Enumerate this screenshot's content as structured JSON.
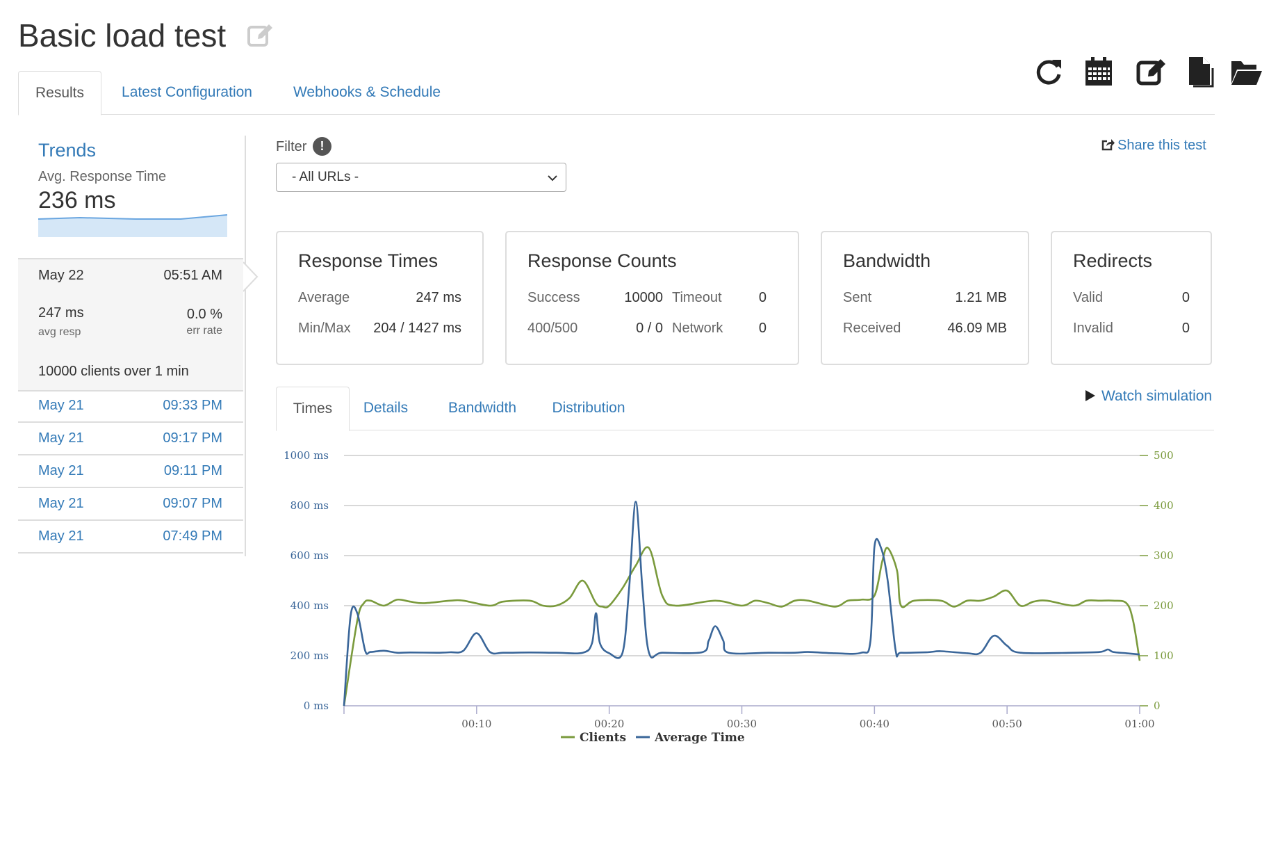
{
  "page": {
    "title": "Basic load test"
  },
  "tabs": [
    {
      "label": "Results",
      "active": true
    },
    {
      "label": "Latest Configuration",
      "active": false
    },
    {
      "label": "Webhooks & Schedule",
      "active": false
    }
  ],
  "toolbar": {
    "icons": [
      "refresh-icon",
      "calendar-icon",
      "edit-icon",
      "copy-file-icon",
      "folder-open-icon"
    ]
  },
  "trends": {
    "title": "Trends",
    "avg_label": "Avg. Response Time",
    "avg_value": "236 ms",
    "selected": {
      "date": "May 22",
      "time": "05:51 AM",
      "avg_resp_value": "247 ms",
      "avg_resp_label": "avg resp",
      "err_rate_value": "0.0 %",
      "err_rate_label": "err rate",
      "clients": "10000 clients over 1 min"
    },
    "runs": [
      {
        "date": "May 21",
        "time": "09:33 PM"
      },
      {
        "date": "May 21",
        "time": "09:17 PM"
      },
      {
        "date": "May 21",
        "time": "09:11 PM"
      },
      {
        "date": "May 21",
        "time": "09:07 PM"
      },
      {
        "date": "May 21",
        "time": "07:49 PM"
      }
    ]
  },
  "filter": {
    "label": "Filter",
    "info": "!",
    "selected": "- All URLs -"
  },
  "share": {
    "label": "Share this test"
  },
  "cards": {
    "response_times": {
      "title": "Response Times",
      "average_label": "Average",
      "average_value": "247 ms",
      "minmax_label": "Min/Max",
      "minmax_value": "204 / 1427 ms"
    },
    "response_counts": {
      "title": "Response Counts",
      "success_label": "Success",
      "success_value": "10000",
      "timeout_label": "Timeout",
      "timeout_value": "0",
      "e400_label": "400/500",
      "e400_value": "0 / 0",
      "network_label": "Network",
      "network_value": "0"
    },
    "bandwidth": {
      "title": "Bandwidth",
      "sent_label": "Sent",
      "sent_value": "1.21 MB",
      "received_label": "Received",
      "received_value": "46.09 MB"
    },
    "redirects": {
      "title": "Redirects",
      "valid_label": "Valid",
      "valid_value": "0",
      "invalid_label": "Invalid",
      "invalid_value": "0"
    }
  },
  "chart_tabs": [
    {
      "label": "Times",
      "active": true
    },
    {
      "label": "Details",
      "active": false
    },
    {
      "label": "Bandwidth",
      "active": false
    },
    {
      "label": "Distribution",
      "active": false
    }
  ],
  "watch": {
    "label": "Watch simulation"
  },
  "colors": {
    "link": "#337ab7",
    "clients": "#7a9a3c",
    "average_time": "#3a6699",
    "grid": "#cccccc"
  },
  "chart_data": {
    "type": "line",
    "x_ticks": [
      "00:10",
      "00:20",
      "00:30",
      "00:40",
      "00:50",
      "01:00"
    ],
    "y_left_ticks": [
      "0 ms",
      "200 ms",
      "400 ms",
      "600 ms",
      "800 ms",
      "1000 ms"
    ],
    "y_right_ticks": [
      "0",
      "100",
      "200",
      "300",
      "400",
      "500"
    ],
    "y_left_range": [
      0,
      1000
    ],
    "y_right_range": [
      0,
      500
    ],
    "x_range_seconds": [
      0,
      60
    ],
    "legend_position": "bottom-center",
    "grid": true,
    "series": [
      {
        "name": "Average Time",
        "axis": "left",
        "color": "#3a6699",
        "x": [
          0,
          0.5,
          1,
          1.6,
          2,
          3,
          4,
          5,
          7,
          8,
          9,
          10,
          11,
          12,
          14,
          16,
          18,
          18.7,
          19,
          19.3,
          20,
          21,
          21.5,
          22,
          22.5,
          23,
          24,
          27,
          27.5,
          28,
          28.6,
          29,
          32,
          34,
          35,
          37,
          39,
          39.7,
          40,
          40.5,
          41,
          41.6,
          42,
          44,
          45,
          47,
          48,
          49,
          50,
          51,
          55,
          57,
          57.6,
          58,
          59,
          60
        ],
        "y": [
          0,
          360,
          370,
          220,
          215,
          220,
          212,
          213,
          212,
          214,
          220,
          290,
          215,
          212,
          213,
          212,
          212,
          250,
          370,
          250,
          210,
          212,
          470,
          815,
          470,
          212,
          212,
          214,
          260,
          318,
          260,
          212,
          212,
          212,
          215,
          210,
          212,
          260,
          635,
          630,
          500,
          220,
          212,
          214,
          218,
          210,
          212,
          280,
          240,
          212,
          212,
          215,
          225,
          215,
          210,
          205
        ]
      },
      {
        "name": "Clients",
        "axis": "right",
        "color": "#7a9a3c",
        "x": [
          0,
          1,
          1.5,
          2,
          3,
          4,
          5,
          6,
          8,
          9,
          11,
          12,
          14,
          15,
          16,
          17,
          18,
          19,
          19.5,
          20,
          21,
          22,
          23,
          24,
          25,
          28,
          30,
          31,
          32,
          33,
          34,
          35,
          37,
          38,
          39,
          40,
          40.6,
          41,
          41.7,
          42,
          43,
          45,
          46,
          47,
          48,
          49,
          50,
          51,
          52,
          53,
          55,
          56,
          57,
          58,
          59,
          59.5,
          60
        ],
        "y": [
          0,
          170,
          205,
          210,
          200,
          212,
          208,
          205,
          210,
          210,
          200,
          208,
          210,
          200,
          200,
          215,
          250,
          205,
          198,
          200,
          235,
          280,
          315,
          220,
          200,
          210,
          200,
          210,
          205,
          198,
          210,
          210,
          198,
          210,
          212,
          220,
          290,
          315,
          270,
          200,
          210,
          210,
          198,
          210,
          210,
          218,
          230,
          200,
          208,
          210,
          200,
          210,
          210,
          210,
          205,
          170,
          90
        ]
      }
    ]
  }
}
